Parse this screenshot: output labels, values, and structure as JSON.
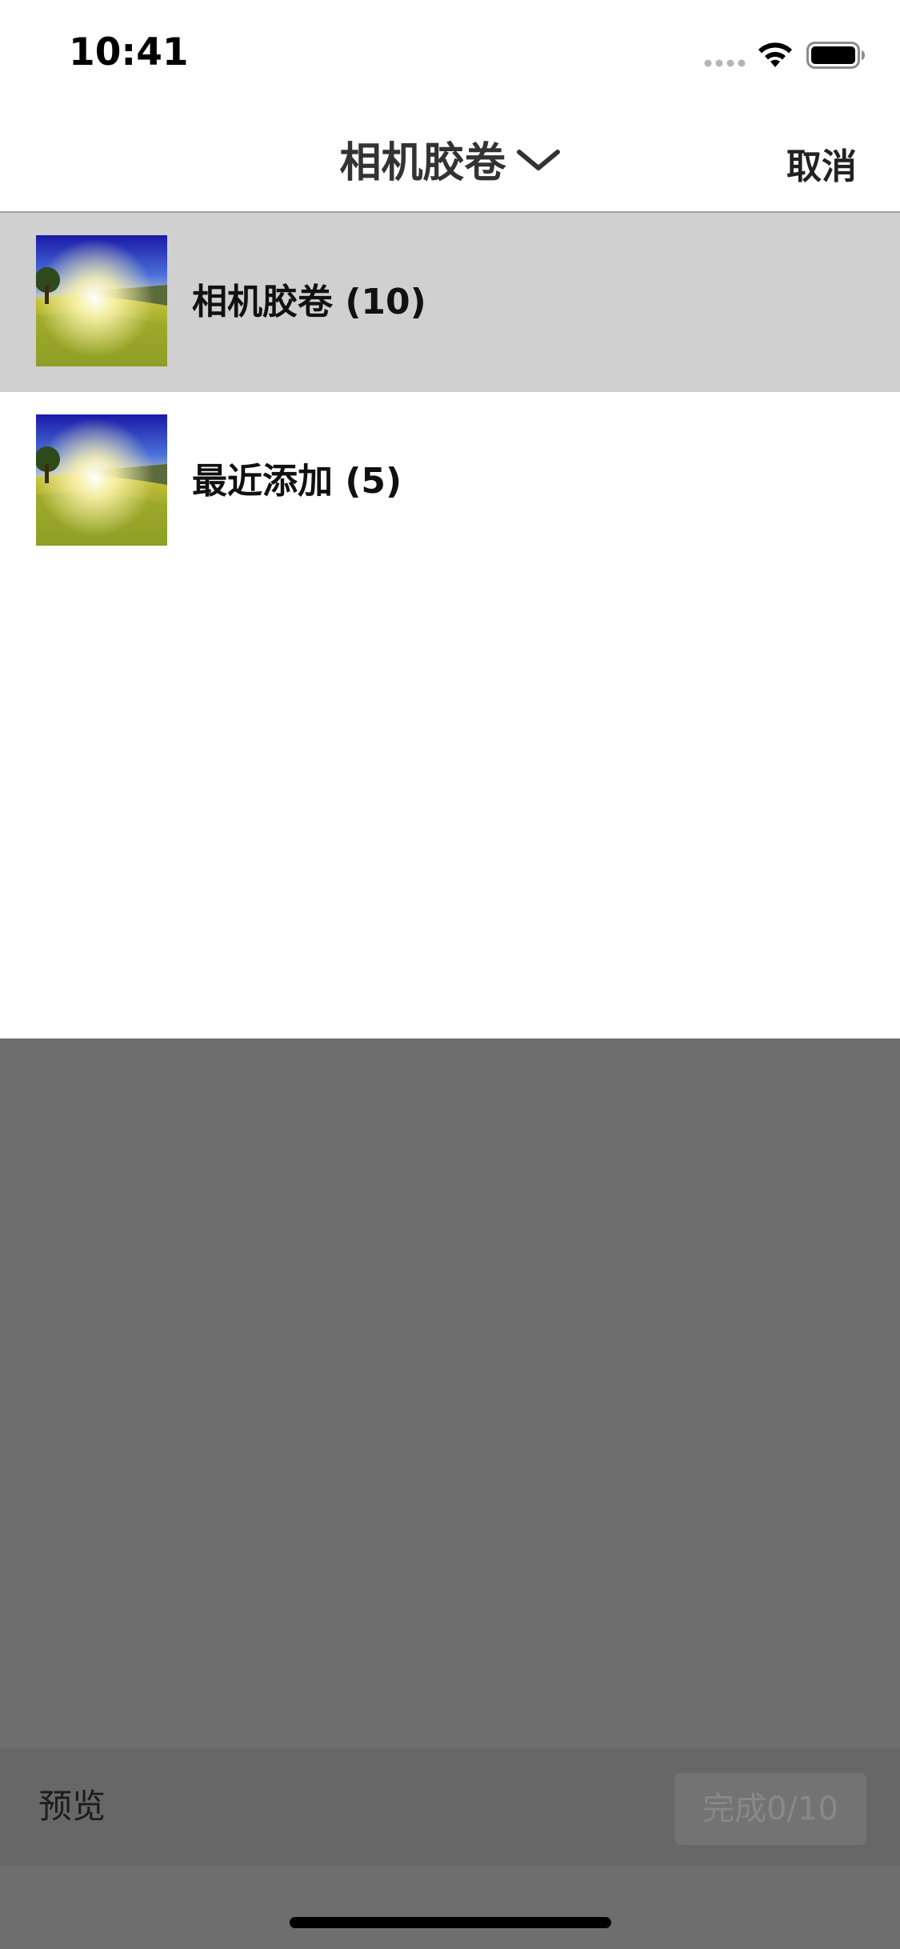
{
  "status_bar": {
    "time": "10:41",
    "icons": [
      "cellular-signal-icon",
      "wifi-icon",
      "battery-icon"
    ]
  },
  "nav": {
    "title": "相机胶卷",
    "cancel_label": "取消",
    "title_icon": "chevron-down-icon"
  },
  "albums": [
    {
      "label": "相机胶卷 (10)",
      "selected": true,
      "thumbnail_icon": "landscape-photo-thumbnail"
    },
    {
      "label": "最近添加 (5)",
      "selected": false,
      "thumbnail_icon": "landscape-photo-thumbnail"
    }
  ],
  "toolbar": {
    "preview_label": "预览",
    "done_label": "完成0/10"
  },
  "colors": {
    "overlay_dim": "#6e6e6e",
    "selected_row": "#d0d0d0",
    "nav_background": "#ffffff"
  }
}
